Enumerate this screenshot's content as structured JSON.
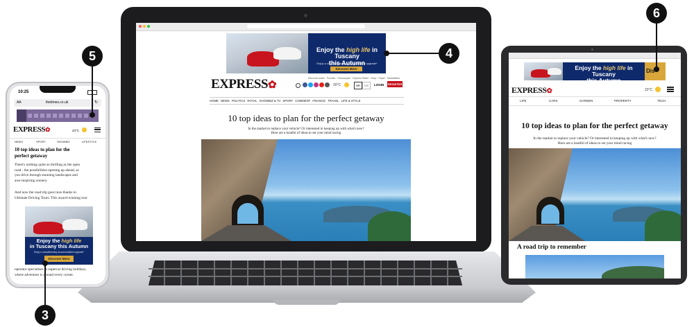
{
  "ad": {
    "headline_1": "Enjoy the",
    "headline_italic": "high life",
    "headline_2": "in Tuscany",
    "headline_3": "this Autumn",
    "subline": "Enjoy a complimentary accommodation upgrade*",
    "button": "Discover More",
    "tablet_cut": "Dis"
  },
  "brand": {
    "logo": "EXPRESS"
  },
  "laptop": {
    "nav": [
      "HOME",
      "NEWS",
      "POLITICS",
      "ROYAL",
      "SHOWBIZ & TV",
      "SPORT",
      "COMMENT",
      "FINANCE",
      "TRAVEL",
      "LIFE & STYLE"
    ],
    "top_links": "Discount codes · Puzzles · Horoscopes · Express Rated · Shop · Paper · Newsletters",
    "temp": "20°C",
    "region": "UK",
    "us": "US",
    "login": "LOGIN",
    "register": "REGISTER"
  },
  "article": {
    "title": "10 top ideas to plan for the perfect getaway",
    "standfirst_1": "In the market to replace your vehicle? Or interested in keeping up with what's new?",
    "standfirst_2": "Here are a boatful of ideas to set your mind racing",
    "subhead": "A road trip to remember"
  },
  "tablet": {
    "nav": [
      "LIFE",
      "CARS",
      "GARDEN",
      "PROPERTY",
      "TECH"
    ],
    "temp": "22°C"
  },
  "phone": {
    "time": "10:25",
    "url_aa": "AA",
    "url": "thetimes.co.uk",
    "temp": "23°C",
    "nav": [
      "NEWS",
      "SPORT",
      "SHOWBIZ",
      "LIFESTYLE"
    ],
    "title_1": "10 top ideas to plan for the",
    "title_2": "perfect getaway",
    "p1_1": "There's nothing quite as thrilling as the open",
    "p1_2": "road - the possibilities opening up ahead, as",
    "p1_3": "you drive through stunning landscapes and",
    "p1_4": "awe-inspiring scenery.",
    "p2_1": "And now the road trip goes luxe thanks to",
    "p2_2": "Ultimate Driving Tours. This award-winning tour",
    "p3_1": "operator specialises in supercar driving holidays,",
    "p3_2": "where adventure is around every corner."
  },
  "callouts": [
    "3",
    "4",
    "5",
    "6"
  ]
}
